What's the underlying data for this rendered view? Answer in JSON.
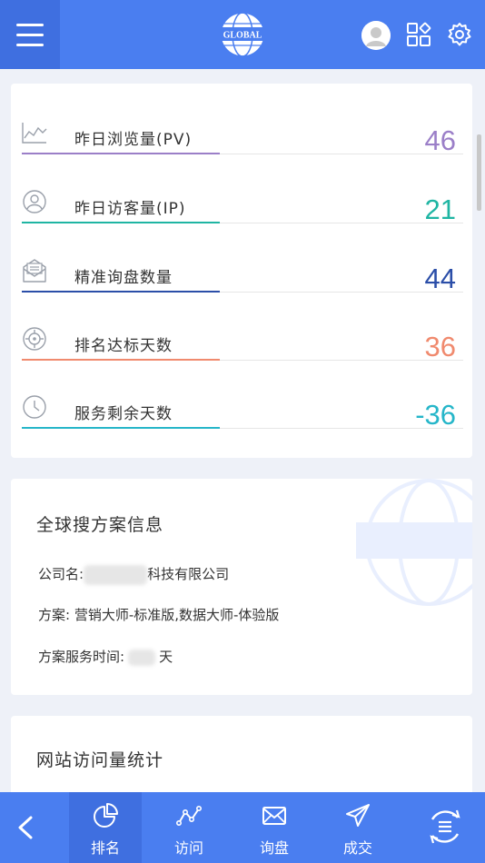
{
  "header": {
    "logo_text": "GLOBAL"
  },
  "stats": [
    {
      "label": "昨日浏览量(PV)",
      "value": "46",
      "color": "#9b7fc8",
      "icon": "line-chart-icon"
    },
    {
      "label": "昨日访客量(IP)",
      "value": "21",
      "color": "#1fb5a3",
      "icon": "visitor-icon"
    },
    {
      "label": "精准询盘数量",
      "value": "44",
      "color": "#2b4ea8",
      "icon": "mail-icon"
    },
    {
      "label": "排名达标天数",
      "value": "36",
      "color": "#f08a6e",
      "icon": "target-icon"
    },
    {
      "label": "服务剩余天数",
      "value": "-36",
      "color": "#26b6c9",
      "icon": "clock-icon"
    }
  ],
  "plan": {
    "title": "全球搜方案信息",
    "company_label": "公司名:",
    "company_suffix": "科技有限公司",
    "plan_text": "方案: 营销大师-标准版,数据大师-体验版",
    "service_label": "方案服务时间:",
    "service_suffix": "天"
  },
  "visit": {
    "title": "网站访问量统计"
  },
  "bottom_nav": [
    {
      "label": "排名",
      "icon": "pie-chart-icon",
      "active": true
    },
    {
      "label": "访问",
      "icon": "trend-icon",
      "active": false
    },
    {
      "label": "询盘",
      "icon": "envelope-icon",
      "active": false
    },
    {
      "label": "成交",
      "icon": "send-icon",
      "active": false
    }
  ],
  "colors": {
    "primary": "#4a7ef0",
    "primary_dark": "#3f6fe0"
  }
}
